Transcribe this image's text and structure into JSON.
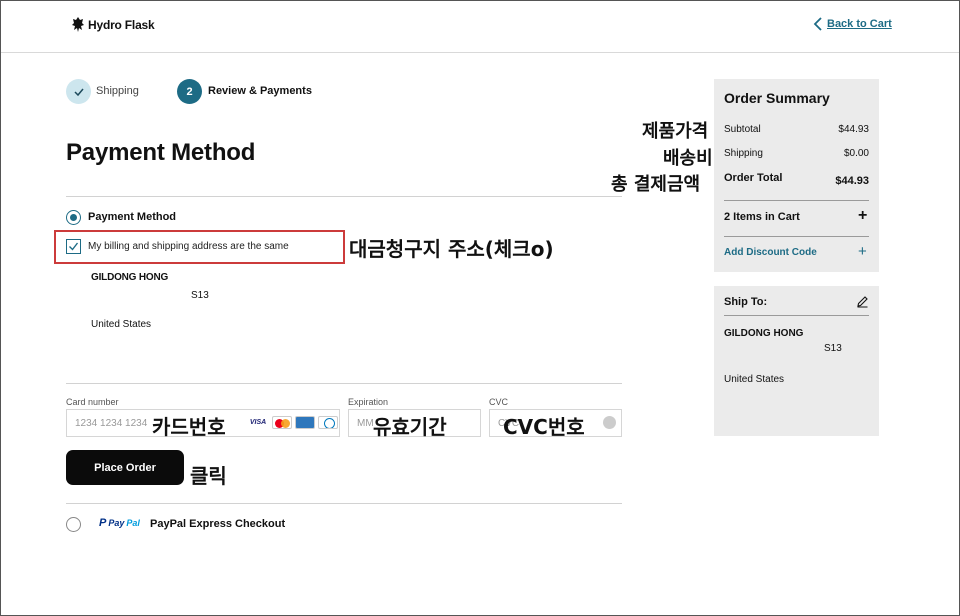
{
  "header": {
    "brand": "Hydro Flask",
    "back_label": "Back to Cart"
  },
  "steps": [
    {
      "label": "Shipping",
      "state": "done"
    },
    {
      "number": "2",
      "label": "Review & Payments",
      "state": "active"
    }
  ],
  "page_title": "Payment Method",
  "payment": {
    "option_label": "Payment Method",
    "billing_same_label": "My billing and shipping address are the same",
    "billing_same_checked": true,
    "address": {
      "name": "GILDONG HONG",
      "line": "S13",
      "country": "United States"
    },
    "card_number": {
      "label": "Card number",
      "placeholder": "1234 1234 1234"
    },
    "expiration": {
      "label": "Expiration",
      "placeholder": "MM"
    },
    "cvc": {
      "label": "CVC",
      "placeholder": "CVC"
    },
    "card_brands": [
      "VISA",
      "mastercard",
      "amex",
      "diners"
    ],
    "place_order_label": "Place Order",
    "paypal_logo": {
      "p": "P",
      "pay": "Pay",
      "pal": "Pal"
    },
    "paypal_label": "PayPal Express Checkout"
  },
  "order_summary": {
    "title": "Order Summary",
    "rows": [
      {
        "label": "Subtotal",
        "value": "$44.93"
      },
      {
        "label": "Shipping",
        "value": "$0.00"
      },
      {
        "label": "Order Total",
        "value": "$44.93"
      }
    ],
    "items_in_cart": "2 Items in Cart",
    "discount_label": "Add Discount Code",
    "plus": "+"
  },
  "ship_to": {
    "title": "Ship To:",
    "name": "GILDONG HONG",
    "line": "S13",
    "country": "United States"
  },
  "annotations": {
    "product_price": "제품가격",
    "shipping_cost": "배송비",
    "total_payment": "총 결제금액",
    "billing_address": "대금청구지 주소(체크o)",
    "card_number": "카드번호",
    "expiry": "유효기간",
    "cvc_number": "CVC번호",
    "click": "클릭"
  },
  "colors": {
    "accent": "#1d6b85",
    "highlight_border": "#cc3b3b",
    "sidebar_bg": "#ebebeb"
  }
}
